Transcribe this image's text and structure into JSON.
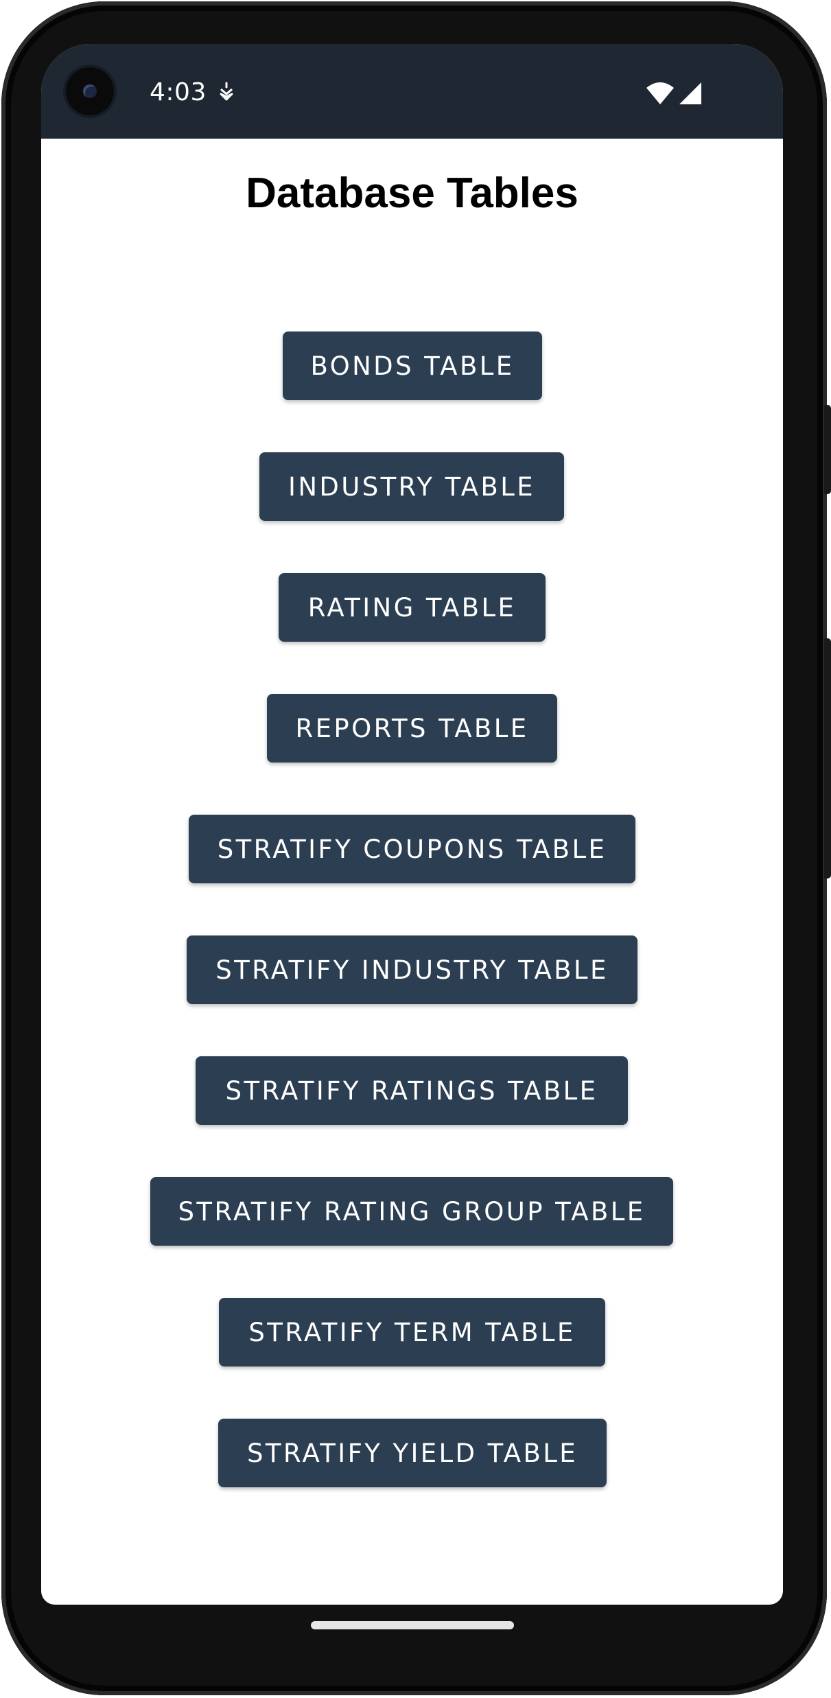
{
  "status_bar": {
    "time": "4:03",
    "icons": [
      "camera-icon",
      "notification-icon",
      "wifi-icon",
      "signal-icon"
    ]
  },
  "screen": {
    "title": "Database Tables",
    "buttons": [
      {
        "label": "BONDS TABLE"
      },
      {
        "label": "INDUSTRY TABLE"
      },
      {
        "label": "RATING TABLE"
      },
      {
        "label": "REPORTS TABLE"
      },
      {
        "label": "STRATIFY COUPONS TABLE"
      },
      {
        "label": "STRATIFY INDUSTRY TABLE"
      },
      {
        "label": "STRATIFY RATINGS TABLE"
      },
      {
        "label": "STRATIFY RATING GROUP TABLE"
      },
      {
        "label": "STRATIFY TERM TABLE"
      },
      {
        "label": "STRATIFY YIELD TABLE"
      }
    ]
  },
  "colors": {
    "status_bar": "#1f2733",
    "button_background": "#2c3e52",
    "button_text": "#ffffff",
    "background": "#ffffff"
  }
}
